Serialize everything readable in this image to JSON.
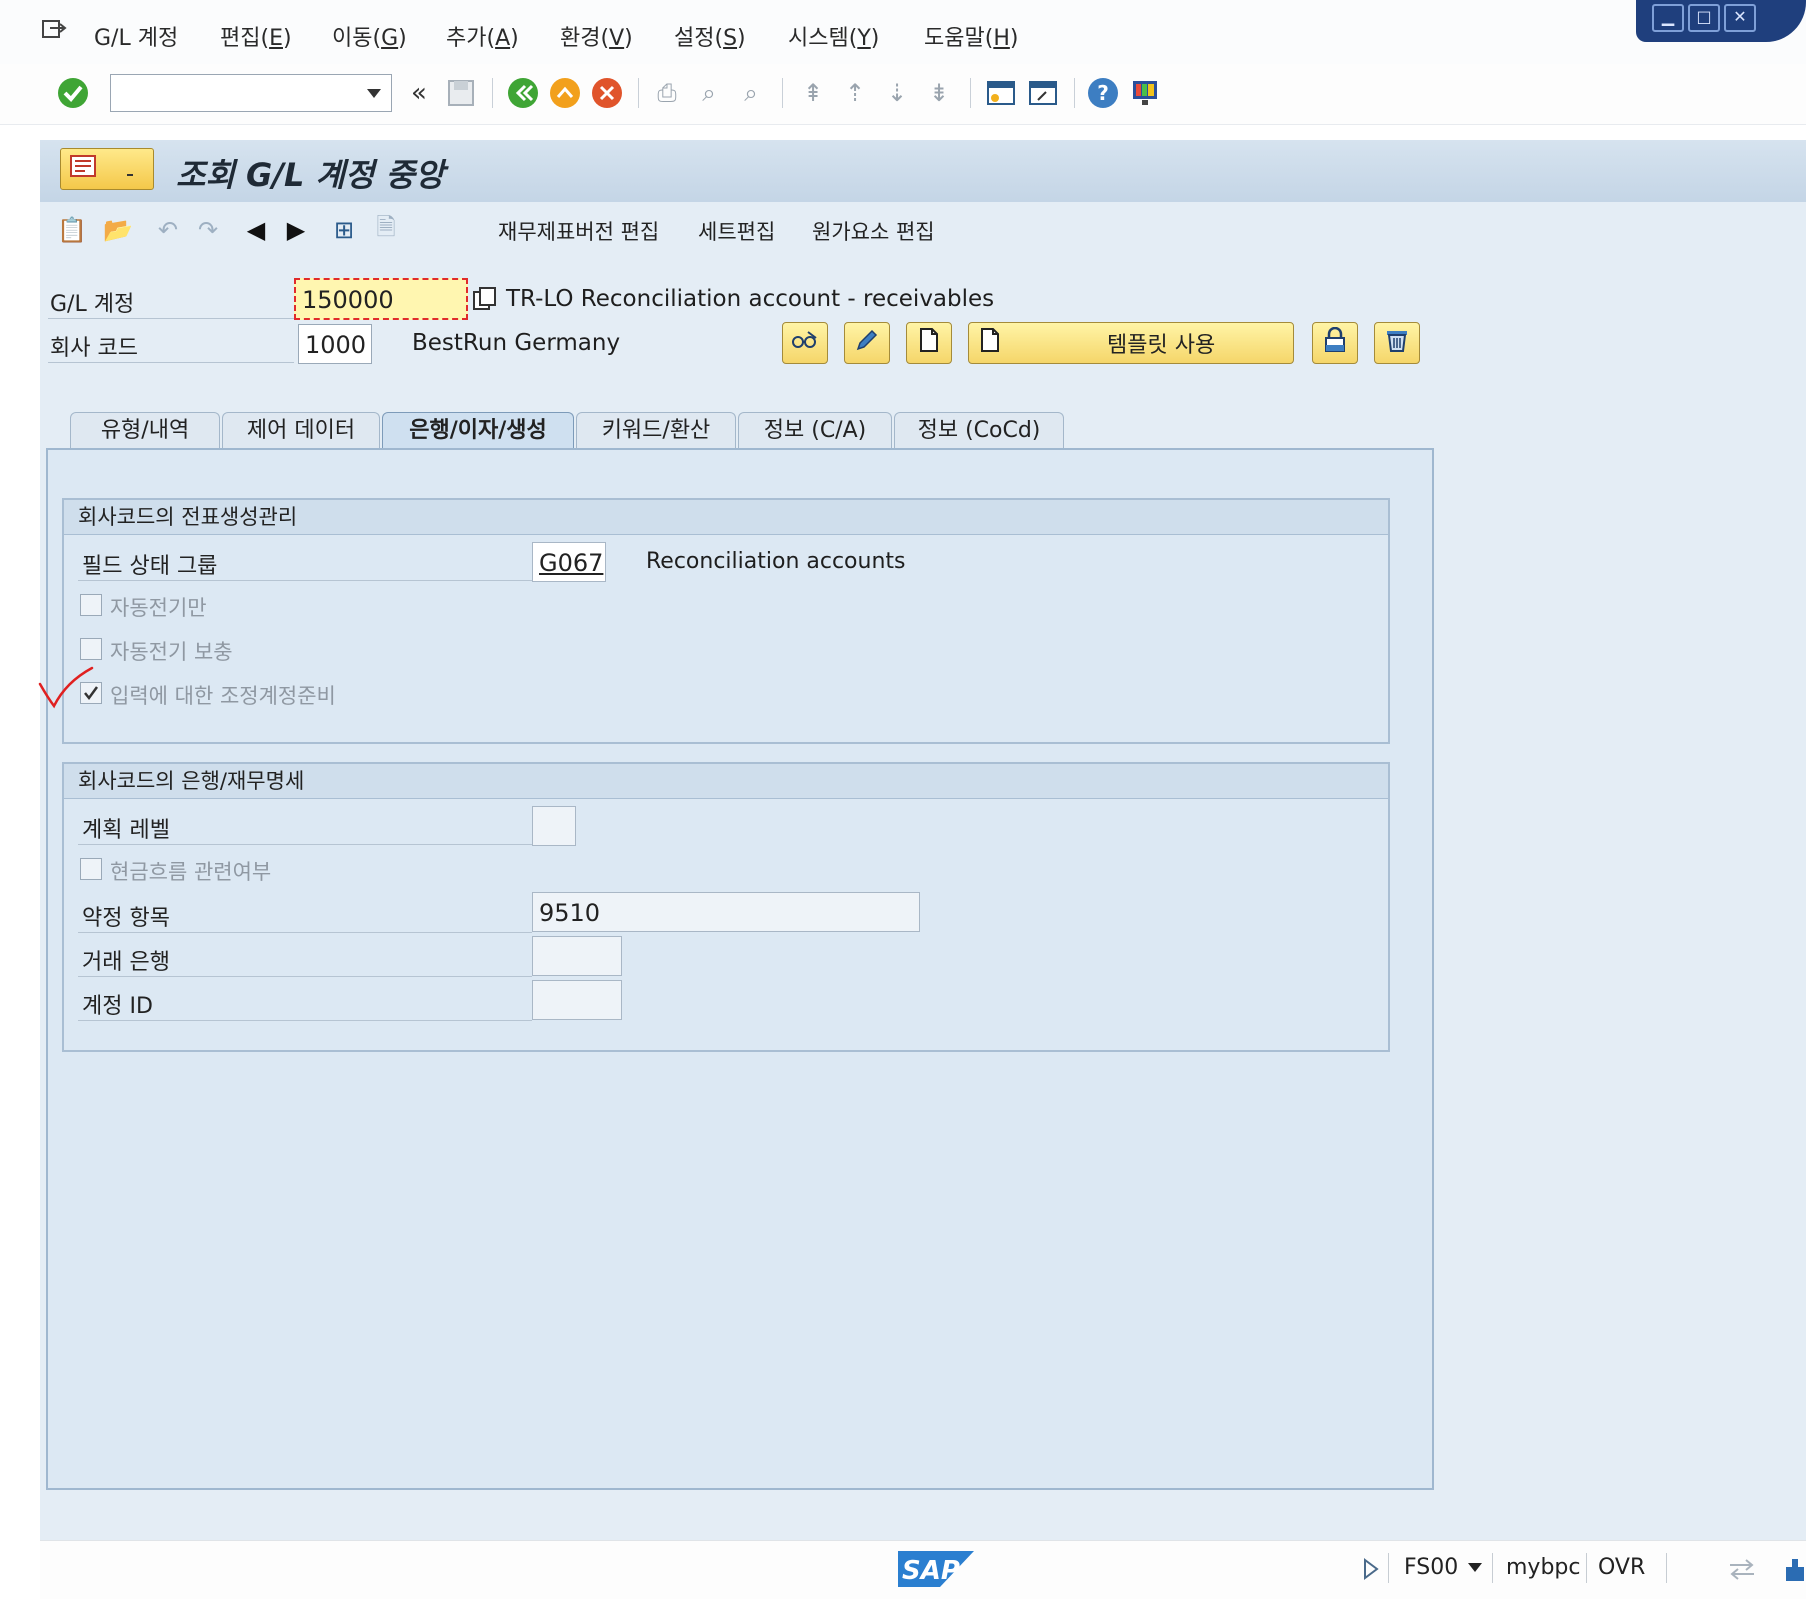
{
  "menu": {
    "items": [
      {
        "pre": "G/L 계정",
        "key": "",
        "post": ""
      },
      {
        "pre": "편집(",
        "key": "E",
        "post": ")"
      },
      {
        "pre": "이동(",
        "key": "G",
        "post": ")"
      },
      {
        "pre": "추가(",
        "key": "A",
        "post": ")"
      },
      {
        "pre": "환경(",
        "key": "V",
        "post": ")"
      },
      {
        "pre": "설정(",
        "key": "S",
        "post": ")"
      },
      {
        "pre": "시스템(",
        "key": "Y",
        "post": ")"
      },
      {
        "pre": "도움말(",
        "key": "H",
        "post": ")"
      }
    ]
  },
  "toolbar": {
    "command_value": "",
    "back_glyph": "«"
  },
  "title": {
    "text": "조회 G/L 계정 중앙"
  },
  "app_toolbar": {
    "edit_fs_version": "재무제표버전 편집",
    "set_edit": "세트편집",
    "cost_element_edit": "원가요소 편집"
  },
  "header": {
    "gl_account_label": "G/L 계정",
    "gl_account_value": "150000",
    "gl_account_desc": "TR-LO Reconciliation account - receivables",
    "company_code_label": "회사 코드",
    "company_code_value": "1000",
    "company_name": "BestRun Germany",
    "template_button": "템플릿 사용"
  },
  "tabs": [
    {
      "label": "유형/내역",
      "active": false
    },
    {
      "label": "제어 데이터",
      "active": false
    },
    {
      "label": "은행/이자/생성",
      "active": true
    },
    {
      "label": "키워드/환산",
      "active": false
    },
    {
      "label": "정보 (C/A)",
      "active": false
    },
    {
      "label": "정보 (CoCd)",
      "active": false
    }
  ],
  "group1": {
    "title": "회사코드의 전표생성관리",
    "field_status_label": "필드 상태 그룹",
    "field_status_value": "G067",
    "field_status_desc": "Reconciliation accounts",
    "auto_post_only_label": "자동전기만",
    "auto_post_only_checked": false,
    "supplement_auto_label": "자동전기 보충",
    "supplement_auto_checked": false,
    "recon_ready_label": "입력에 대한 조정계정준비",
    "recon_ready_checked": true
  },
  "group2": {
    "title": "회사코드의 은행/재무명세",
    "planning_level_label": "계획 레벨",
    "planning_level_value": "",
    "cash_flow_label": "현금흐름 관련여부",
    "cash_flow_checked": false,
    "commitment_label": "약정 항목",
    "commitment_value": "9510",
    "house_bank_label": "거래 은행",
    "house_bank_value": "",
    "account_id_label": "계정 ID",
    "account_id_value": ""
  },
  "status": {
    "logo": "SAP",
    "transaction": "FS00",
    "server": "mybpc",
    "mode": "OVR"
  },
  "colors": {
    "accent": "#1f3f7d",
    "panel": "#dce8f3",
    "button_yellow": "#f5d66a"
  }
}
